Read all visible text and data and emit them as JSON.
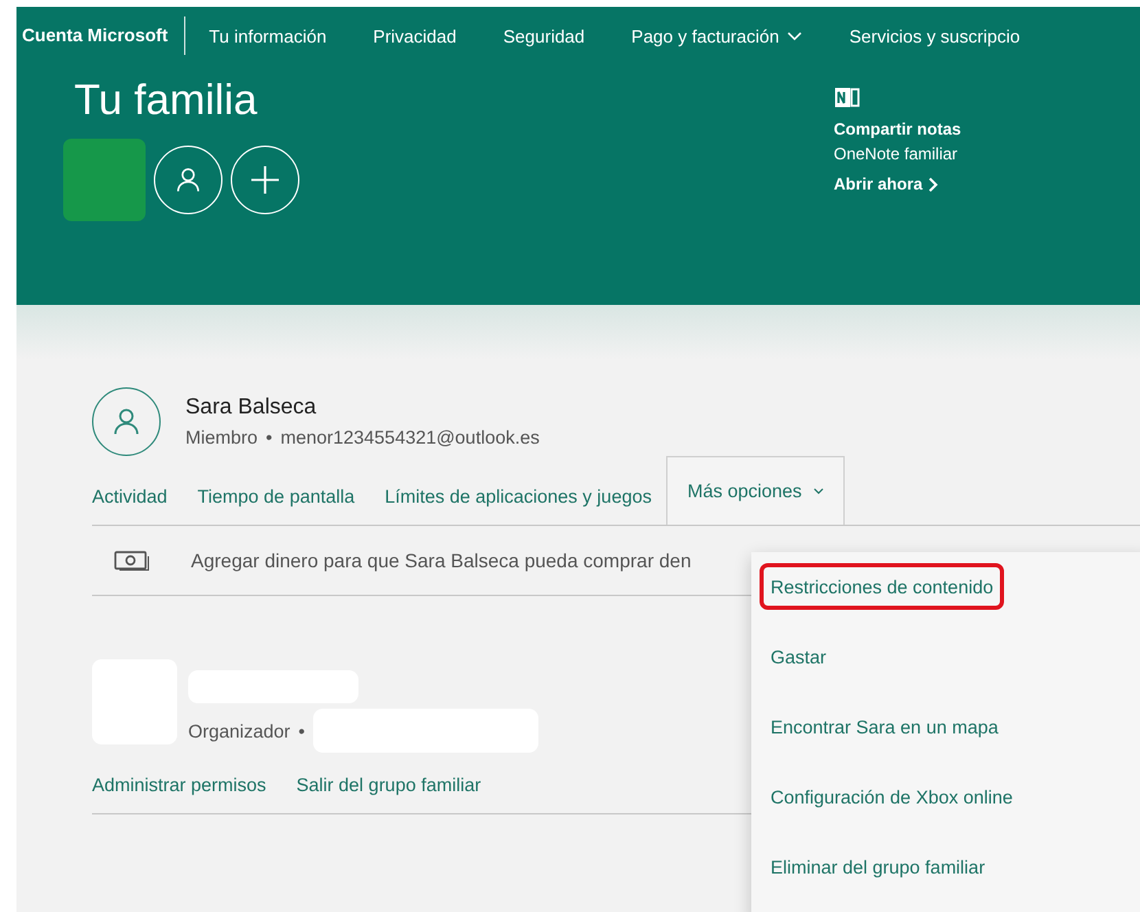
{
  "nav": {
    "brand": "Cuenta Microsoft",
    "items": [
      {
        "label": "Tu información",
        "dropdown": false
      },
      {
        "label": "Privacidad",
        "dropdown": false
      },
      {
        "label": "Seguridad",
        "dropdown": false
      },
      {
        "label": "Pago y facturación",
        "dropdown": true
      },
      {
        "label": "Servicios y suscripcio",
        "dropdown": false
      }
    ]
  },
  "hero": {
    "title": "Tu familia",
    "promo": {
      "title": "Compartir notas",
      "subtitle": "OneNote familiar",
      "link": "Abrir ahora"
    }
  },
  "member": {
    "name": "Sara Balseca",
    "role": "Miembro",
    "separator": "•",
    "email": "menor1234554321@outlook.es",
    "actions": [
      "Actividad",
      "Tiempo de pantalla",
      "Límites de aplicaciones y juegos"
    ],
    "more_options": {
      "label": "Más opciones",
      "expanded": true
    },
    "notice": "Agregar dinero para que Sara Balseca pueda comprar den"
  },
  "menu": [
    {
      "label": "Restricciones de contenido",
      "highlighted": true
    },
    {
      "label": "Gastar",
      "highlighted": false
    },
    {
      "label": "Encontrar Sara en un mapa",
      "highlighted": false
    },
    {
      "label": "Configuración de Xbox online",
      "highlighted": false
    },
    {
      "label": "Eliminar del grupo familiar",
      "highlighted": false
    }
  ],
  "organizer": {
    "role": "Organizador",
    "separator": "•",
    "actions": [
      "Administrar permisos",
      "Salir del grupo familiar"
    ]
  }
}
